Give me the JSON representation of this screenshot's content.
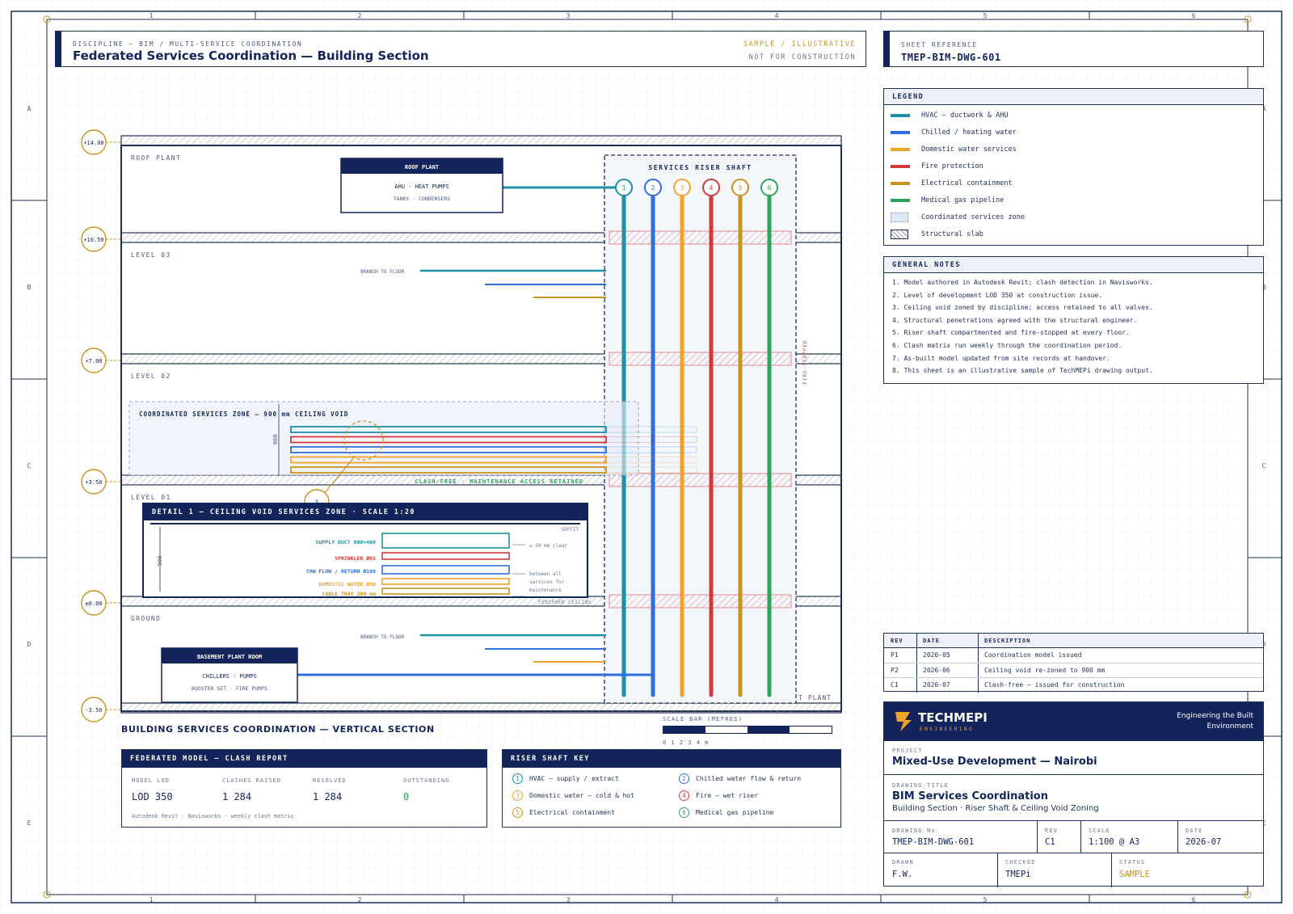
{
  "grid_refs": {
    "top": [
      "1",
      "2",
      "3",
      "4",
      "5",
      "6"
    ],
    "side": [
      "A",
      "B",
      "C",
      "D",
      "E"
    ]
  },
  "header": {
    "discipline": "DISCIPLINE — BIM / MULTI-SERVICE COORDINATION",
    "title": "Federated Services Coordination — Building Section",
    "sample": "SAMPLE / ILLUSTRATIVE",
    "not_for_construction": "NOT FOR CONSTRUCTION"
  },
  "sheet_ref": {
    "label": "SHEET REFERENCE",
    "value": "TMEP-BIM-DWG-601"
  },
  "legend": {
    "title": "LEGEND",
    "items": [
      {
        "label": "HVAC — ductwork & AHU",
        "color": "#1e8fa8"
      },
      {
        "label": "Chilled / heating water",
        "color": "#2f6fdc"
      },
      {
        "label": "Domestic water services",
        "color": "#f2a12a"
      },
      {
        "label": "Fire protection",
        "color": "#d23a3a"
      },
      {
        "label": "Electrical containment",
        "color": "#c8941e"
      },
      {
        "label": "Medical gas pipeline",
        "color": "#2ea45a"
      },
      {
        "label": "Coordinated services zone",
        "color": "#dfe9f7"
      },
      {
        "label": "Structural slab",
        "color": "#ffffff"
      }
    ]
  },
  "notes": {
    "title": "GENERAL NOTES",
    "items": [
      "1. Model authored in Autodesk Revit; clash detection in Navisworks.",
      "2. Level of development LOD 350 at construction issue.",
      "3. Ceiling void zoned by discipline; access retained to all valves.",
      "4. Structural penetrations agreed with the structural engineer.",
      "5. Riser shaft compartmented and fire-stopped at every floor.",
      "6. Clash matrix run weekly through the coordination period.",
      "7. As-built model updated from site records at handover.",
      "8. This sheet is an illustrative sample of TechMEPi drawing output."
    ]
  },
  "section": {
    "levels": [
      {
        "elev": "+14.00"
      },
      {
        "elev": "+10.50",
        "name": "ROOF PLANT"
      },
      {
        "elev": "+7.00",
        "name": "LEVEL 03"
      },
      {
        "elev": "+3.50",
        "name": "LEVEL 02"
      },
      {
        "elev": "±0.00",
        "name": "LEVEL 01"
      },
      {
        "elev": "-3.50",
        "name": "GROUND"
      }
    ],
    "roof_plant_box": {
      "title": "ROOF PLANT",
      "line1": "AHU · HEAT PUMPS",
      "line2": "TANKS · CONDENSERS"
    },
    "basement_box": {
      "title": "BASEMENT PLANT ROOM",
      "line1": "CHILLERS · PUMPS",
      "line2": "BOOSTER SET · FIRE PUMPS"
    },
    "riser_title": "SERVICES RISER SHAFT",
    "riser_numbers": [
      "1",
      "2",
      "3",
      "4",
      "5",
      "6"
    ],
    "branch_label": "BRANCH TO FLOOR",
    "fire_stopped": "FIRE-STOPPED",
    "zone_title": "COORDINATED SERVICES ZONE — 900 mm CEILING VOID",
    "zone_dim": "900",
    "clash_free": "CLASH-FREE · MAINTENANCE ACCESS RETAINED",
    "callout": "1",
    "basement_tag": "T PLANT",
    "caption": "BUILDING SERVICES COORDINATION — VERTICAL SECTION"
  },
  "detail": {
    "title": "DETAIL 1 — CEILING VOID SERVICES ZONE · SCALE 1:20",
    "soffit": "SOFFIT",
    "dim": "900",
    "rows": [
      {
        "label": "SUPPLY DUCT 800×400",
        "color": "#1e8fa8"
      },
      {
        "label": "SPRINKLER Ø65",
        "color": "#d23a3a"
      },
      {
        "label": "CHW FLOW / RETURN Ø100",
        "color": "#2f6fdc"
      },
      {
        "label": "DOMESTIC WATER Ø50",
        "color": "#f2a12a"
      },
      {
        "label": "CABLE TRAY 300 mm",
        "color": "#c8941e"
      }
    ],
    "note1": "≥ 50 mm clear",
    "note2": "between all",
    "note3": "services for",
    "note4": "maintenance",
    "finished_ceiling": "FINISHED CEILING"
  },
  "scale_bar": {
    "label": "SCALE BAR (METRES)",
    "ticks": "0 1 2 3 4 m"
  },
  "clash_report": {
    "title": "FEDERATED MODEL — CLASH REPORT",
    "stats": [
      {
        "label": "MODEL LOD",
        "value": "LOD 350"
      },
      {
        "label": "CLASHES RAISED",
        "value": "1 284"
      },
      {
        "label": "RESOLVED",
        "value": "1 284"
      },
      {
        "label": "OUTSTANDING",
        "value": "0"
      }
    ],
    "footer": "Autodesk Revit · Navisworks · weekly clash matrix"
  },
  "riser_key": {
    "title": "RISER SHAFT KEY",
    "items": [
      {
        "num": "1",
        "label": "HVAC — supply / extract",
        "color": "#1e8fa8"
      },
      {
        "num": "2",
        "label": "Chilled water flow & return",
        "color": "#2f6fdc"
      },
      {
        "num": "3",
        "label": "Domestic water — cold & hot",
        "color": "#f2a12a"
      },
      {
        "num": "4",
        "label": "Fire — wet riser",
        "color": "#d23a3a"
      },
      {
        "num": "5",
        "label": "Electrical containment",
        "color": "#c8941e"
      },
      {
        "num": "6",
        "label": "Medical gas pipeline",
        "color": "#2ea45a"
      }
    ]
  },
  "revisions": {
    "headers": [
      "REV",
      "DATE",
      "DESCRIPTION"
    ],
    "rows": [
      [
        "P1",
        "2026-05",
        "Coordination model issued"
      ],
      [
        "P2",
        "2026-06",
        "Ceiling void re-zoned to 900 mm"
      ],
      [
        "C1",
        "2026-07",
        "Clash-free — issued for construction"
      ]
    ]
  },
  "title_block": {
    "brand": "TECHMEPI",
    "brand_sub": "ENGINEERING",
    "tagline1": "Engineering the Built",
    "tagline2": "Environment",
    "project_label": "PROJECT",
    "project": "Mixed-Use Development — Nairobi",
    "drawing_title_label": "DRAWING TITLE",
    "drawing_title": "BIM Services Coordination",
    "drawing_sub": "Building Section · Riser Shaft & Ceiling Void Zoning",
    "drawing_no_label": "DRAWING No.",
    "drawing_no": "TMEP-BIM-DWG-601",
    "rev_label": "REV",
    "rev": "C1",
    "scale_label": "SCALE",
    "scale": "1:100 @ A3",
    "date_label": "DATE",
    "date": "2026-07",
    "drawn_label": "DRAWN",
    "drawn": "F.W.",
    "checked_label": "CHECKED",
    "checked": "TMEPi",
    "status_label": "STATUS",
    "status": "SAMPLE"
  },
  "colors": {
    "navy": "#13245a",
    "accent": "#c8941e",
    "green": "#2ea45a",
    "red": "#d23a3a"
  }
}
